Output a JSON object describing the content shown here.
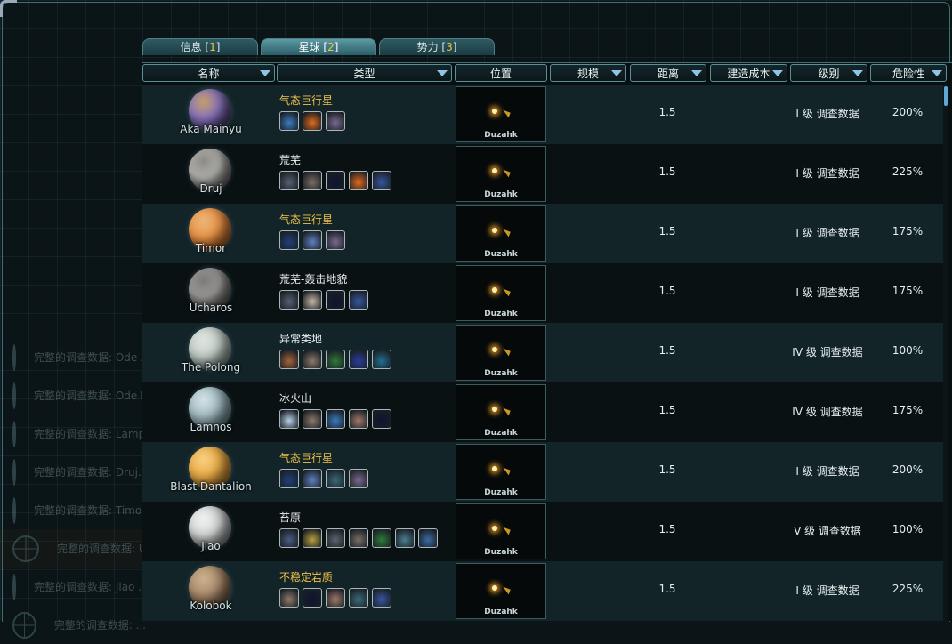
{
  "tabs": [
    {
      "label": "信息 [",
      "key": "1",
      "end": "]",
      "active": false
    },
    {
      "label": "星球 [",
      "key": "2",
      "end": "]",
      "active": true
    },
    {
      "label": "势力 [",
      "key": "3",
      "end": "]",
      "active": false
    }
  ],
  "columns": [
    "名称",
    "类型",
    "位置",
    "规模",
    "距离",
    "建造成本",
    "级别",
    "危险性"
  ],
  "background_list": [
    "完整的调查数据: Ode ...",
    "完整的调查数据: Ode Mainyu ... 计划",
    "完整的调查数据: Lampol...",
    "完整的调查数据: Druj...",
    "完整的调查数据: Timor...",
    "完整的调查数据: Ucharos ...",
    "完整的调查数据: Jiao ...",
    "完整的调查数据: ..."
  ],
  "rows": [
    {
      "name": "Aka Mainyu",
      "type": "气态巨行星",
      "type_color": "#f0c24a",
      "planet_colors": [
        "#8c78c0",
        "#3a2a60",
        "#c59d6a"
      ],
      "features": [
        "#3b7bbf",
        "#e36a1c",
        "#7a6a90"
      ],
      "location": "Duzahk",
      "distance": "1.5",
      "level": "I 级 调查数据",
      "danger": "200%"
    },
    {
      "name": "Druj",
      "type": "荒芜",
      "type_color": "#e8edf0",
      "planet_colors": [
        "#b4b4b0",
        "#55524e",
        "#8d8a84"
      ],
      "features": [
        "#556070",
        "#7a6e66",
        "#0e1430",
        "#e36a1c",
        "#3656a0"
      ],
      "location": "Duzahk",
      "distance": "1.5",
      "level": "I 级 调查数据",
      "danger": "225%"
    },
    {
      "name": "Timor",
      "type": "气态巨行星",
      "type_color": "#f0c24a",
      "planet_colors": [
        "#f09a4a",
        "#b24f1c",
        "#e7b47a"
      ],
      "features": [
        "#1f3f78",
        "#6080c0",
        "#7a6a90"
      ],
      "location": "Duzahk",
      "distance": "1.5",
      "level": "I 级 调查数据",
      "danger": "175%"
    },
    {
      "name": "Ucharos",
      "type": "荒芜-轰击地貌",
      "type_color": "#e8edf0",
      "planet_colors": [
        "#9d9c9a",
        "#4a4846",
        "#7c7a78"
      ],
      "features": [
        "#556070",
        "#c9b8a8",
        "#0e1430",
        "#3656a0"
      ],
      "location": "Duzahk",
      "distance": "1.5",
      "level": "I 级 调查数据",
      "danger": "175%"
    },
    {
      "name": "The Polong",
      "type": "异常类地",
      "type_color": "#e8edf0",
      "planet_colors": [
        "#c8d2cc",
        "#6f8a80",
        "#dde4e0"
      ],
      "features": [
        "#a2643a",
        "#8d7a6a",
        "#2e7a3a",
        "#2a3ca0",
        "#1f7090"
      ],
      "location": "Duzahk",
      "distance": "1.5",
      "level": "IV 级 调查数据",
      "danger": "100%"
    },
    {
      "name": "Lamnos",
      "type": "冰火山",
      "type_color": "#e8edf0",
      "planet_colors": [
        "#a8c2c8",
        "#5a7a84",
        "#d2e0e4"
      ],
      "features": [
        "#b8d0e8",
        "#8d7a6a",
        "#3b7bbf",
        "#a07a6a",
        "#0e1430"
      ],
      "location": "Duzahk",
      "distance": "1.5",
      "level": "IV 级 调查数据",
      "danger": "175%"
    },
    {
      "name": "Blast Dantalion",
      "type": "气态巨行星",
      "type_color": "#f0c24a",
      "planet_colors": [
        "#f0b24c",
        "#b3741e",
        "#f6cf80"
      ],
      "features": [
        "#1f3f78",
        "#6080c0",
        "#3a6a7a",
        "#7a6a90"
      ],
      "location": "Duzahk",
      "distance": "1.5",
      "level": "I 级 调查数据",
      "danger": "200%"
    },
    {
      "name": "Jiao",
      "type": "苔原",
      "type_color": "#e8edf0",
      "planet_colors": [
        "#d8dada",
        "#6a6f72",
        "#eef0f0"
      ],
      "features": [
        "#4a5a80",
        "#b8a040",
        "#5a6470",
        "#7a6e66",
        "#2e7a3a",
        "#4a8090",
        "#3a6aa0"
      ],
      "location": "Duzahk",
      "distance": "1.5",
      "level": "V 级 调查数据",
      "danger": "100%"
    },
    {
      "name": "Kolobok",
      "type": "不稳定岩质",
      "type_color": "#f0c24a",
      "planet_colors": [
        "#b09070",
        "#5a4632",
        "#cbb08c"
      ],
      "features": [
        "#8d7a6a",
        "#0e1430",
        "#a07a6a",
        "#3a6a7a",
        "#3656a0"
      ],
      "location": "Duzahk",
      "distance": "1.5",
      "level": "I 级 调查数据",
      "danger": "225%"
    }
  ]
}
